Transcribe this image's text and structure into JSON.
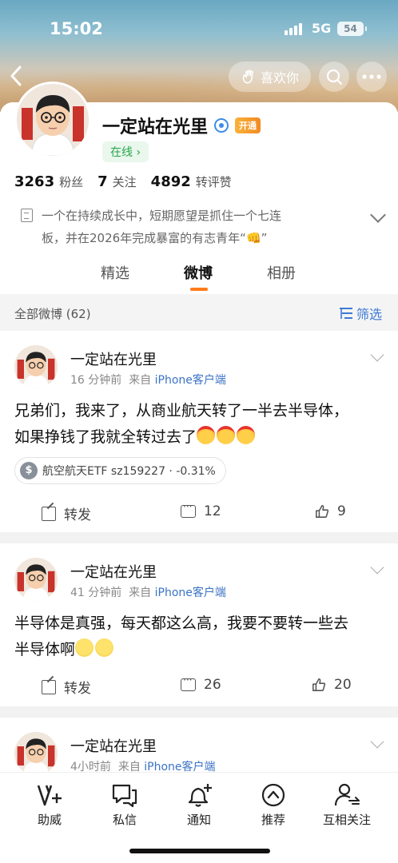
{
  "status_bar": {
    "time": "15:02",
    "network": "5G",
    "battery": "54"
  },
  "header": {
    "like_label": "喜欢你"
  },
  "profile": {
    "name": "一定站在光里",
    "vip_badge": "开通",
    "online_label": "在线 ›",
    "stats": [
      {
        "value": "3263",
        "label": "粉丝"
      },
      {
        "value": "7",
        "label": "关注"
      },
      {
        "value": "4892",
        "label": "转评赞"
      }
    ],
    "bio_line1": "一个在持续成长中，短期愿望是抓住一个七连",
    "bio_line2": "板，并在2026年完成暴富的有志青年“👊”"
  },
  "tabs": [
    {
      "label": "精选",
      "active": false
    },
    {
      "label": "微博",
      "active": true
    },
    {
      "label": "相册",
      "active": false
    }
  ],
  "filter": {
    "count_label": "全部微博 (62)",
    "filter_label": "筛选"
  },
  "posts": [
    {
      "author": "一定站在光里",
      "time": "16 分钟前",
      "source_prefix": "来自",
      "source": "iPhone客户端",
      "text_line1": "兄弟们，我来了，从商业航天转了一半去半导体，",
      "text_line2": "如果挣钱了我就全转过去了",
      "stock": "航空航天ETF sz159227 · -0.31%",
      "repost_label": "转发",
      "comments": "12",
      "likes": "9"
    },
    {
      "author": "一定站在光里",
      "time": "41 分钟前",
      "source_prefix": "来自",
      "source": "iPhone客户端",
      "text_line1": "半导体是真强，每天都这么高，我要不要转一些去",
      "text_line2": "半导体啊",
      "repost_label": "转发",
      "comments": "26",
      "likes": "20"
    },
    {
      "author": "一定站在光里",
      "time": "4小时前",
      "source_prefix": "来自",
      "source": "iPhone客户端"
    }
  ],
  "bottom_nav": [
    {
      "label": "助威",
      "icon": "cheer-v-plus-icon"
    },
    {
      "label": "私信",
      "icon": "message-icon"
    },
    {
      "label": "通知",
      "icon": "bell-plus-icon"
    },
    {
      "label": "推荐",
      "icon": "recommend-up-icon"
    },
    {
      "label": "互相关注",
      "icon": "mutual-follow-icon"
    }
  ],
  "colors": {
    "accent_orange": "#ff7a1a",
    "link_blue": "#3b73c5",
    "online_green": "#27a64a"
  }
}
